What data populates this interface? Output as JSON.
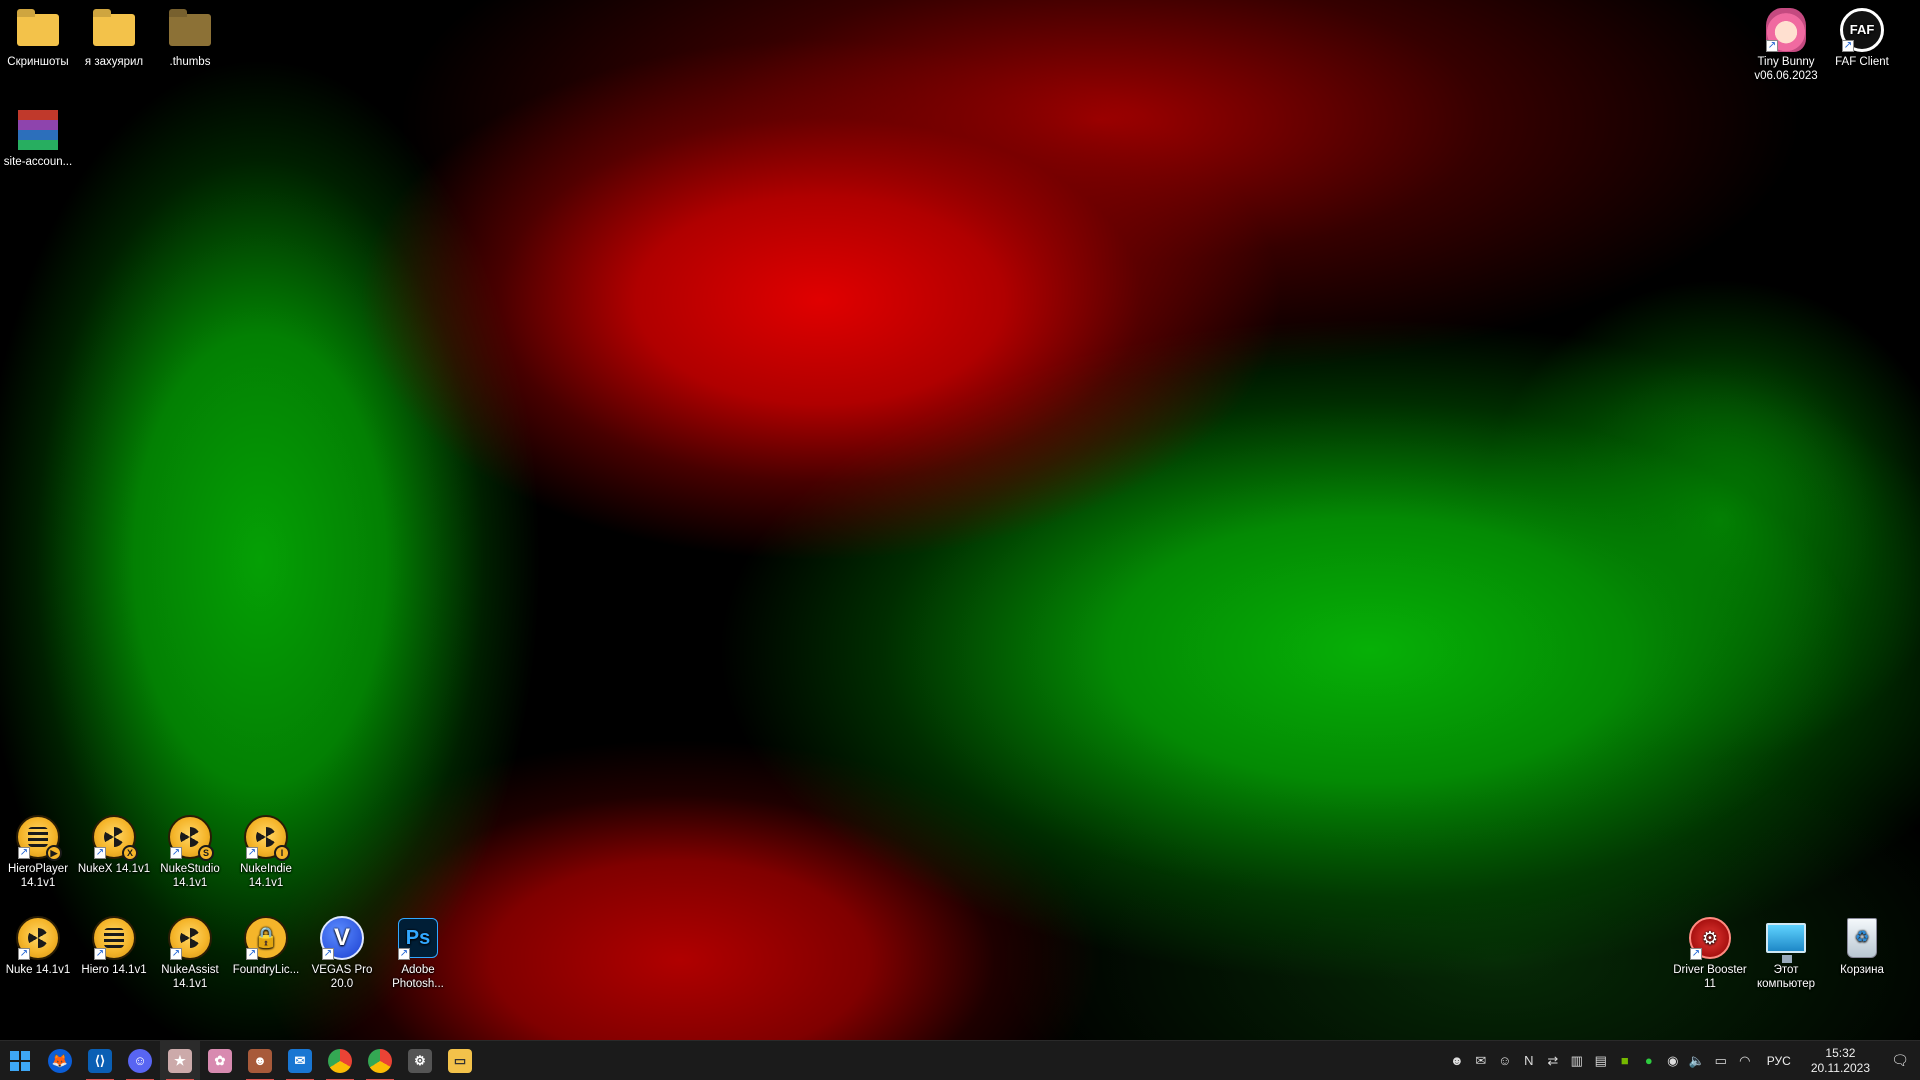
{
  "desktop": {
    "icons": {
      "screenshots": "Скриншоты",
      "ya_zakhuyaril": "я захуярил",
      "thumbs": ".thumbs",
      "site_account": "site-accoun...",
      "tiny_bunny": "Tiny Bunny v06.06.2023",
      "faf_client": "FAF Client",
      "hieroplayer": "HieroPlayer 14.1v1",
      "nukex": "NukeX 14.1v1",
      "nukestudio": "NukeStudio 14.1v1",
      "nukeindie": "NukeIndie 14.1v1",
      "nuke": "Nuke 14.1v1",
      "hiero": "Hiero 14.1v1",
      "nukeassist": "NukeAssist 14.1v1",
      "foundrylic": "FoundryLic...",
      "vegas": "VEGAS Pro 20.0",
      "photoshop": "Adobe Photosh...",
      "driver_booster": "Driver Booster 11",
      "this_pc": "Этот компьютер",
      "recycle_bin": "Корзина"
    },
    "badges": {
      "nukex": "X",
      "nukestudio": "S",
      "nukeindie": "I",
      "hieroplayer": "▶"
    },
    "glyphs": {
      "vegas": "V",
      "photoshop": "Ps",
      "faf": "FAF"
    }
  },
  "taskbar": {
    "start_icon": "windows-start-icon",
    "apps": [
      "firefox-icon",
      "vscode-icon",
      "discord-icon",
      "game-icon-1",
      "game-icon-2",
      "game-icon-3",
      "outlook-icon",
      "chrome-icon",
      "chrome-icon-2",
      "settings-icon",
      "file-explorer-icon"
    ],
    "language": "РУС",
    "time": "15:32",
    "date": "20.11.2023"
  },
  "colors": {
    "taskbar_bg": "#1b1b1b",
    "accent_blue": "#3ea7f5",
    "wallpaper_red": "#e00000",
    "wallpaper_green": "#06b006"
  }
}
